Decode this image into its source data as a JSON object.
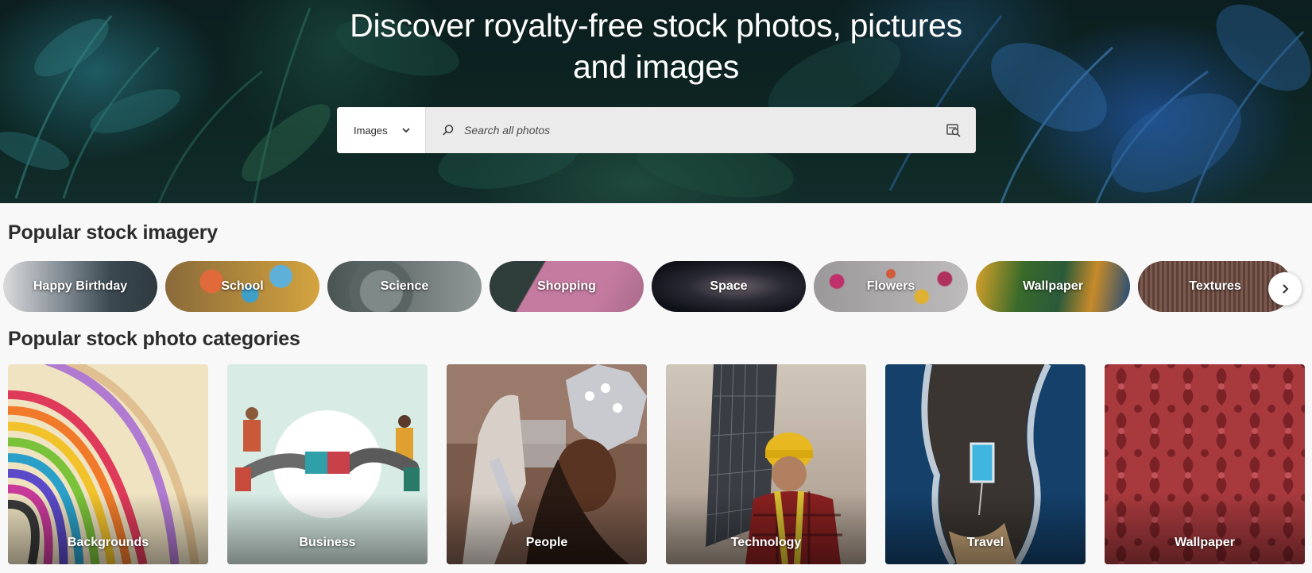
{
  "hero": {
    "title_line1": "Discover royalty-free stock photos, pictures",
    "title_line2": "and images"
  },
  "search": {
    "type_selected": "Images",
    "placeholder": "Search all photos",
    "value": ""
  },
  "icons": {
    "type_dropdown": "chevron-down-icon",
    "search": "search-icon",
    "visual_search": "visual-search-icon",
    "carousel_next": "chevron-right-icon"
  },
  "popular_imagery": {
    "title": "Popular stock imagery",
    "items": [
      {
        "label": "Happy Birthday",
        "colors": [
          "#c8c9cc",
          "#3c4a52"
        ]
      },
      {
        "label": "School",
        "colors": [
          "#d9a441",
          "#6a4c2a"
        ]
      },
      {
        "label": "Science",
        "colors": [
          "#4b5653",
          "#9aa3a1"
        ]
      },
      {
        "label": "Shopping",
        "colors": [
          "#c77ea3",
          "#2f3d3b"
        ]
      },
      {
        "label": "Space",
        "colors": [
          "#141722",
          "#4d4a52"
        ]
      },
      {
        "label": "Flowers",
        "colors": [
          "#b8b6b7",
          "#8a8788"
        ]
      },
      {
        "label": "Wallpaper",
        "colors": [
          "#2f5a2a",
          "#d3a12b"
        ]
      },
      {
        "label": "Textures",
        "colors": [
          "#5e4038",
          "#a5877c"
        ]
      }
    ]
  },
  "popular_categories": {
    "title": "Popular stock photo categories",
    "items": [
      {
        "label": "Backgrounds"
      },
      {
        "label": "Business"
      },
      {
        "label": "People"
      },
      {
        "label": "Technology"
      },
      {
        "label": "Travel"
      },
      {
        "label": "Wallpaper"
      }
    ]
  }
}
